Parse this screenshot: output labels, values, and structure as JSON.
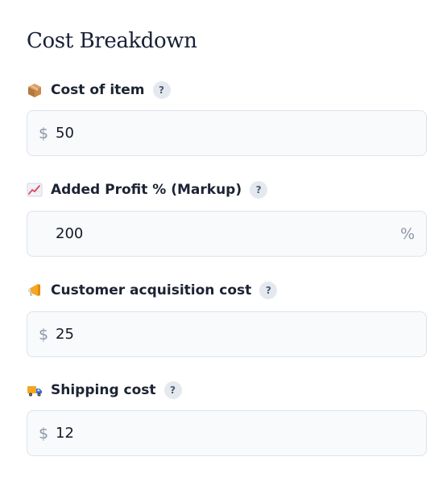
{
  "section": {
    "title": "Cost Breakdown"
  },
  "fields": [
    {
      "label": "Cost of item",
      "icon": "package-icon",
      "help": "?",
      "prefix": "$",
      "suffix": "",
      "value": "50"
    },
    {
      "label": "Added Profit % (Markup)",
      "icon": "chart-increasing-icon",
      "help": "?",
      "prefix": "",
      "suffix": "%",
      "value": "200"
    },
    {
      "label": "Customer acquisition cost",
      "icon": "megaphone-icon",
      "help": "?",
      "prefix": "$",
      "suffix": "",
      "value": "25"
    },
    {
      "label": "Shipping cost",
      "icon": "delivery-truck-icon",
      "help": "?",
      "prefix": "$",
      "suffix": "",
      "value": "12"
    }
  ],
  "colors": {
    "field_background": "#f8fafc",
    "field_border": "#dde3ec",
    "help_badge": "#e4e9f0",
    "affix_text": "#8c97a8"
  }
}
